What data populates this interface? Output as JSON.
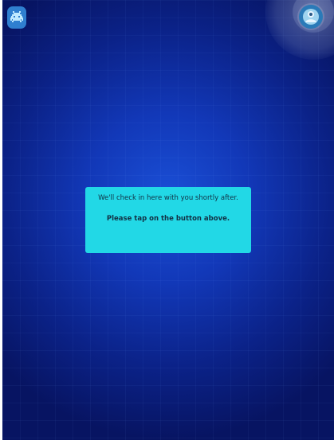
{
  "top_left": {
    "icon": "space-invader-icon"
  },
  "top_right": {
    "icon": "user-profile-icon"
  },
  "message": {
    "line1": "We'll check in here with you shortly after.",
    "line2": "Please tap on the button above."
  },
  "colors": {
    "background_center": "#1a4fd6",
    "background_edge": "#071462",
    "message_bg": "#22d8e6",
    "icon_bg": "#2f7fd0"
  }
}
